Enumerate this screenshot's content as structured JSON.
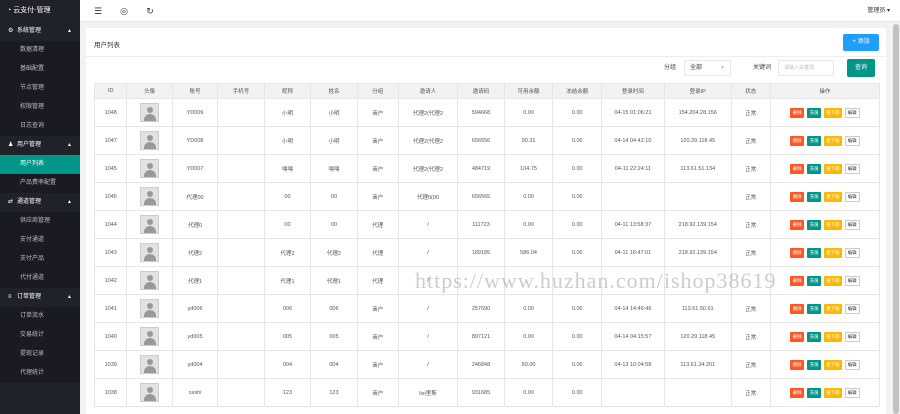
{
  "app": {
    "title": "云支付-管理"
  },
  "header": {
    "admin_label": "管理员 ▾"
  },
  "sidebar": {
    "groups": [
      {
        "label": "系统管理",
        "icon": "gear-icon",
        "items": [
          "数据清理",
          "基础配置",
          "节点管理",
          "权限管理",
          "日志查询"
        ]
      },
      {
        "label": "用户管理",
        "icon": "user-icon",
        "items": [
          "用户列表",
          "产品费率配置"
        ]
      },
      {
        "label": "通道管理",
        "icon": "channel-icon",
        "items": [
          "供应商管理",
          "支付通道",
          "支付产品",
          "代付通道"
        ]
      },
      {
        "label": "订单管理",
        "icon": "list-icon",
        "items": [
          "订单流水",
          "交易统计",
          "提现记录",
          "代理统计"
        ]
      }
    ],
    "active_item": "用户列表"
  },
  "page": {
    "title": "用户列表",
    "add_label": "+ 添加",
    "filter": {
      "group_label": "分组",
      "group_value": "全部",
      "keyword_label": "关键词",
      "keyword_placeholder": "请输入关键词",
      "search_label": "查询"
    },
    "columns": [
      "ID",
      "头像",
      "账号",
      "手机号",
      "昵称",
      "姓名",
      "分组",
      "邀请人",
      "邀请码",
      "可用余额",
      "冻结余额",
      "登录时间",
      "登录IP",
      "状态",
      "操作"
    ],
    "ops": [
      "删除",
      "充值",
      "查下级",
      "编辑"
    ],
    "rows": [
      {
        "id": "1048",
        "account": "YD009",
        "phone": "",
        "nick": "小明",
        "name": "小明",
        "group": "商户",
        "inviter": "代理2(代理2",
        "code": "594668",
        "avail": "0.00",
        "frozen": "0.00",
        "login_time": "04-15 01:06:21",
        "login_ip": "154.204.28.156",
        "status": "正常"
      },
      {
        "id": "1047",
        "account": "YD008",
        "phone": "",
        "nick": "小明",
        "name": "小明",
        "group": "商户",
        "inviter": "代理2(代理2",
        "code": "656556",
        "avail": "90.31",
        "frozen": "0.00",
        "login_time": "04-14 04:42:10",
        "login_ip": "120.29.118.45",
        "status": "正常"
      },
      {
        "id": "1045",
        "account": "YD007",
        "phone": "",
        "nick": "嘿嘿",
        "name": "嘿嘿",
        "group": "商户",
        "inviter": "代理2(代理2",
        "code": "484719",
        "avail": "104.75",
        "frozen": "0.00",
        "login_time": "04-11 22:24:11",
        "login_ip": "113.61.51.134",
        "status": "正常"
      },
      {
        "id": "1045",
        "account": "代理00",
        "phone": "",
        "nick": "00",
        "name": "00",
        "group": "商户",
        "inviter": "代理0(00",
        "code": "656565",
        "avail": "0.00",
        "frozen": "0.00",
        "login_time": "",
        "login_ip": "",
        "status": "正常"
      },
      {
        "id": "1044",
        "account": "代理0",
        "phone": "",
        "nick": "00",
        "name": "00",
        "group": "代理",
        "inviter": "/",
        "code": "111723",
        "avail": "0.00",
        "frozen": "0.00",
        "login_time": "04-11 13:58:37",
        "login_ip": "218.92.139.154",
        "status": "正常"
      },
      {
        "id": "1043",
        "account": "代理2",
        "phone": "",
        "nick": "代理2",
        "name": "代理2",
        "group": "代理",
        "inviter": "/",
        "code": "189185",
        "avail": "586.04",
        "frozen": "0.00",
        "login_time": "04-11 16:47:01",
        "login_ip": "218.92.139.154",
        "status": "正常"
      },
      {
        "id": "1042",
        "account": "代理1",
        "phone": "",
        "nick": "代理1",
        "name": "代理1",
        "group": "代理",
        "inviter": "/",
        "code": "",
        "avail": "",
        "frozen": "",
        "login_time": "",
        "login_ip": "",
        "status": ""
      },
      {
        "id": "1041",
        "account": "yd006",
        "phone": "",
        "nick": "006",
        "name": "006",
        "group": "商户",
        "inviter": "/",
        "code": "257690",
        "avail": "0.00",
        "frozen": "0.00",
        "login_time": "04-14 14:46:46",
        "login_ip": "113.61.50.61",
        "status": "正常"
      },
      {
        "id": "1040",
        "account": "yd005",
        "phone": "",
        "nick": "005",
        "name": "005",
        "group": "商户",
        "inviter": "/",
        "code": "897121",
        "avail": "0.00",
        "frozen": "0.00",
        "login_time": "04-14 04:15:57",
        "login_ip": "120.29.118.45",
        "status": "正常"
      },
      {
        "id": "1039",
        "account": "yd004",
        "phone": "",
        "nick": "004",
        "name": "004",
        "group": "商户",
        "inviter": "/",
        "code": "246848",
        "avail": "50.00",
        "frozen": "0.00",
        "login_time": "04-13 10:04:58",
        "login_ip": "113.61.34.201",
        "status": "正常"
      },
      {
        "id": "1038",
        "account": "ceshi",
        "phone": "",
        "nick": "123",
        "name": "123",
        "group": "商户",
        "inviter": "lixi里斯",
        "code": "931685",
        "avail": "0.00",
        "frozen": "0.00",
        "login_time": "",
        "login_ip": "",
        "status": "正常"
      }
    ]
  },
  "watermark": "https://www.huzhan.com/ishop38619",
  "colors": {
    "sidebar_bg": "#20222a",
    "active": "#009688",
    "primary": "#1e9fff",
    "danger": "#ff5722",
    "warn": "#ffb800"
  }
}
